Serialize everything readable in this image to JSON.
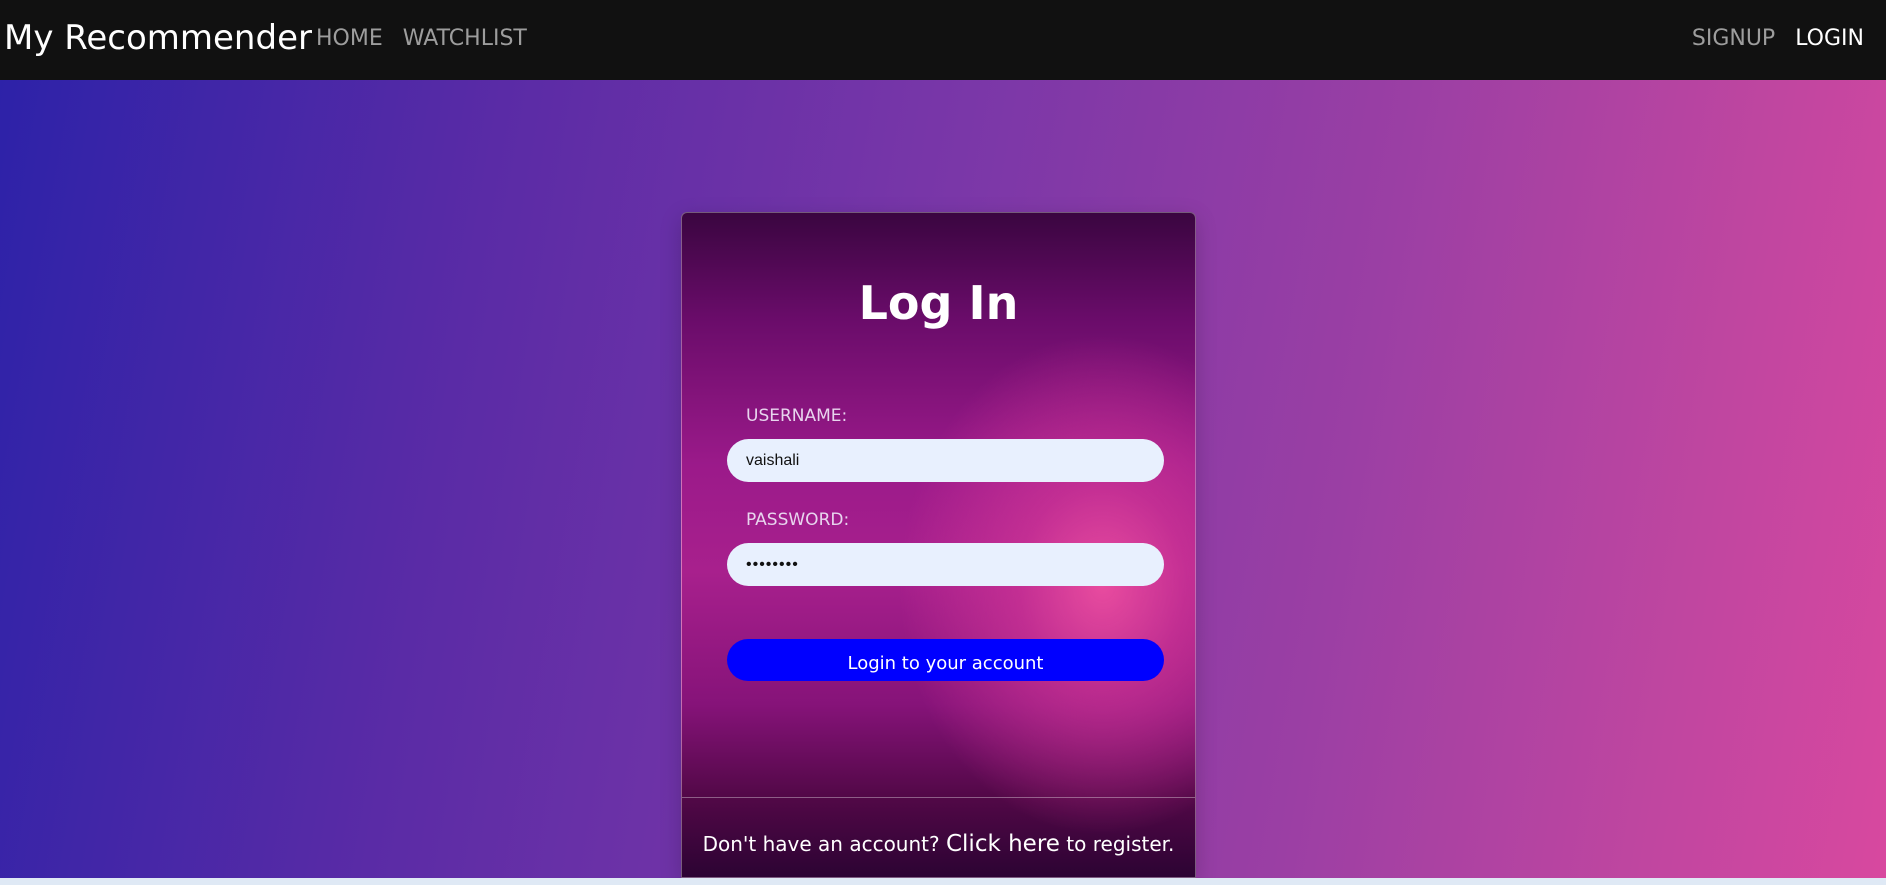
{
  "navbar": {
    "brand": "My Recommender",
    "left_links": [
      {
        "label": "HOME"
      },
      {
        "label": "WATCHLIST"
      }
    ],
    "right_links": [
      {
        "label": "SIGNUP"
      },
      {
        "label": "LOGIN"
      }
    ]
  },
  "login_card": {
    "title": "Log In",
    "username_label": "USERNAME:",
    "username_value": "vaishali",
    "password_label": "PASSWORD:",
    "password_value": "••••••••",
    "submit_label": "Login to your account",
    "register_prefix": "Don't have an account? ",
    "register_link": "Click here",
    "register_suffix": " to register."
  },
  "colors": {
    "navbar_bg": "#111111",
    "button_blue": "#0000ff",
    "input_bg": "#e8f0fe",
    "gradient_start": "#2d22a8",
    "gradient_end": "#d8489f"
  }
}
